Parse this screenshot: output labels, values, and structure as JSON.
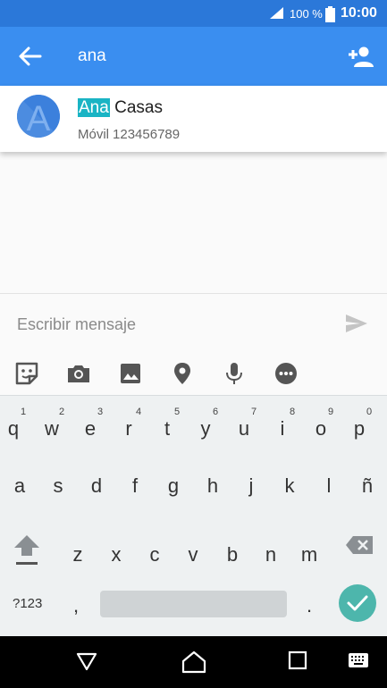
{
  "status_bar": {
    "battery_percent": "100 %",
    "time": "10:00",
    "signal_icon": "signal-icon",
    "battery_icon": "battery-icon"
  },
  "app_bar": {
    "search_query": "ana",
    "back_icon": "arrow-back-icon",
    "add_contact_icon": "person-add-icon"
  },
  "search_result": {
    "avatar_letter": "A",
    "name_highlight": "Ana",
    "name_rest": "Casas",
    "phone_label": "Móvil",
    "phone_number": "123456789"
  },
  "composer": {
    "placeholder": "Escribir mensaje",
    "send_icon": "send-icon"
  },
  "attachments": [
    "sticker-icon",
    "camera-icon",
    "image-icon",
    "location-icon",
    "mic-icon",
    "more-icon"
  ],
  "keyboard": {
    "row1": [
      {
        "key": "q",
        "num": "1"
      },
      {
        "key": "w",
        "num": "2"
      },
      {
        "key": "e",
        "num": "3"
      },
      {
        "key": "r",
        "num": "4"
      },
      {
        "key": "t",
        "num": "5"
      },
      {
        "key": "y",
        "num": "6"
      },
      {
        "key": "u",
        "num": "7"
      },
      {
        "key": "i",
        "num": "8"
      },
      {
        "key": "o",
        "num": "9"
      },
      {
        "key": "p",
        "num": "0"
      }
    ],
    "row2": [
      "a",
      "s",
      "d",
      "f",
      "g",
      "h",
      "j",
      "k",
      "l",
      "ñ"
    ],
    "row3": [
      "z",
      "x",
      "c",
      "v",
      "b",
      "n",
      "m"
    ],
    "symbols_label": "?123",
    "comma": ",",
    "period": ".",
    "accent_color": "#4db6ac"
  },
  "colors": {
    "status_bar": "#2b78d9",
    "app_bar": "#3a8ef0",
    "highlight": "#1ab4c4"
  }
}
